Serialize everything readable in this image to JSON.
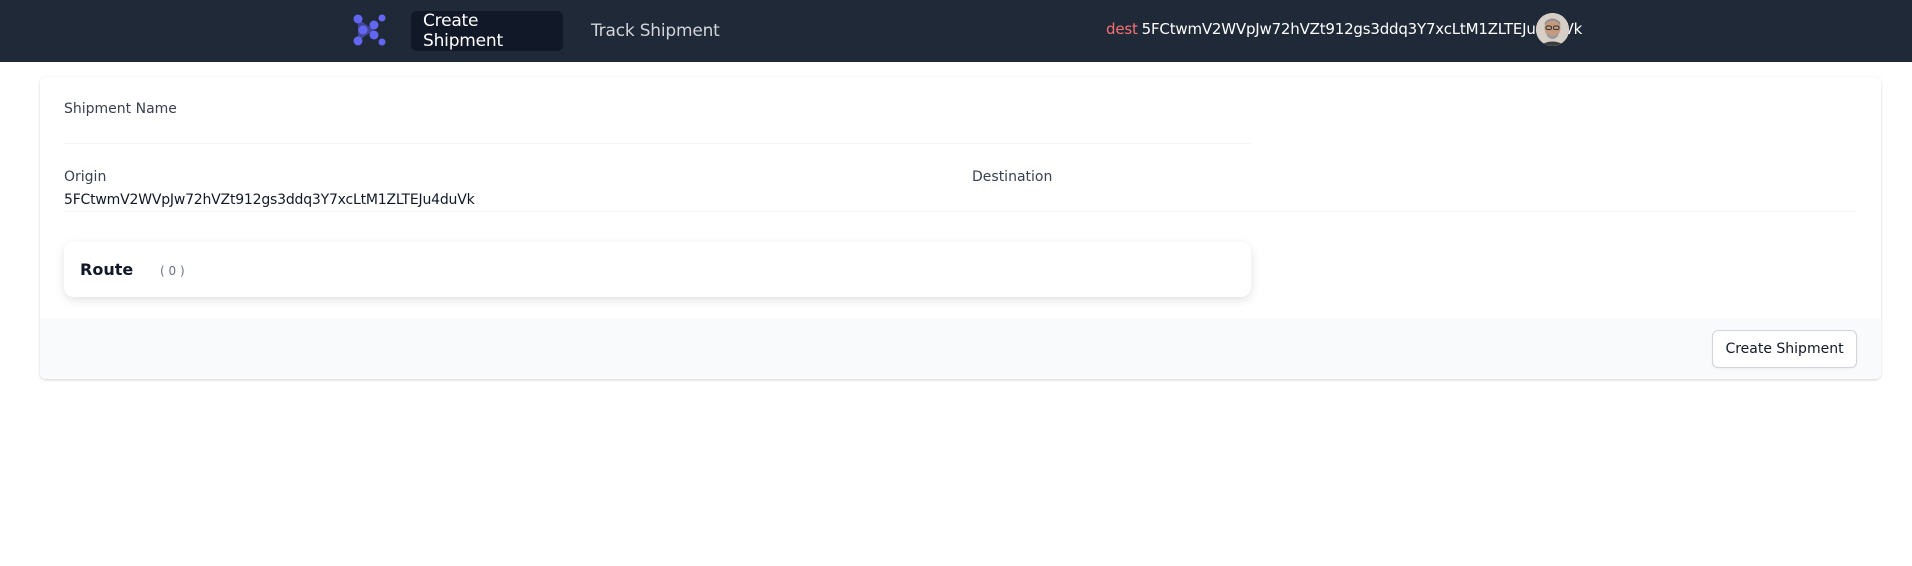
{
  "nav": {
    "logo_icon": "app-logo-icon",
    "tabs": [
      {
        "label": "Create Shipment",
        "active": true
      },
      {
        "label": "Track Shipment",
        "active": false
      }
    ],
    "account": {
      "prefix": "dest",
      "address": "5FCtwmV2WVpJw72hVZt912gs3ddq3Y7xcLtM1ZLTEJu4duVk",
      "avatar_icon": "user-avatar"
    }
  },
  "form": {
    "shipment_name": {
      "label": "Shipment Name",
      "value": "",
      "placeholder": ""
    },
    "origin": {
      "label": "Origin",
      "value": "5FCtwmV2WVpJw72hVZt912gs3ddq3Y7xcLtM1ZLTEJu4duVk"
    },
    "destination": {
      "label": "Destination",
      "value": ""
    },
    "route": {
      "title": "Route",
      "count": "( 0 )"
    },
    "submit_label": "Create Shipment"
  },
  "colors": {
    "navbar_bg": "#1f2937",
    "active_tab_bg": "#111827",
    "logo": "#6366f1",
    "account_prefix": "#f87171"
  }
}
